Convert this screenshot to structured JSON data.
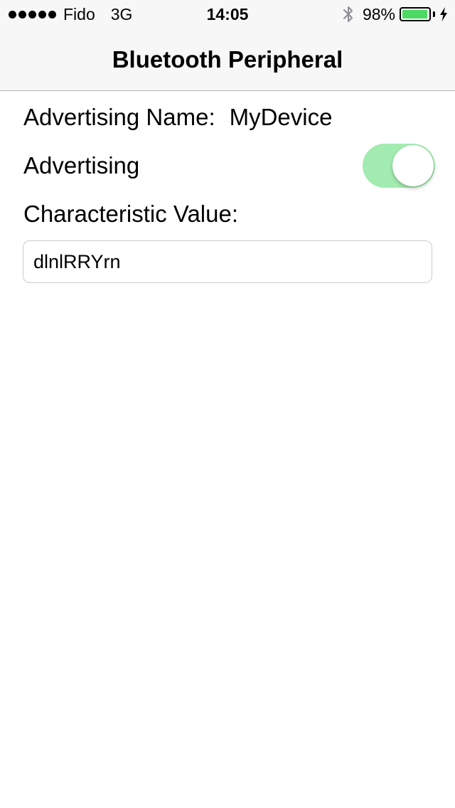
{
  "status_bar": {
    "signal_dots": 5,
    "carrier": "Fido",
    "network": "3G",
    "time": "14:05",
    "bluetooth_icon": "bluetooth-icon",
    "battery_percent": "98%",
    "battery_level": 0.98,
    "charging_icon": "bolt-icon",
    "battery_color": "#4cd964"
  },
  "nav": {
    "title": "Bluetooth Peripheral"
  },
  "content": {
    "advertising_name_label": "Advertising Name:",
    "advertising_name_value": "MyDevice",
    "advertising_label": "Advertising",
    "advertising_on": true,
    "switch_color": "#a3ecb1",
    "characteristic_label": "Characteristic Value:",
    "characteristic_value": "dlnlRRYrn"
  }
}
